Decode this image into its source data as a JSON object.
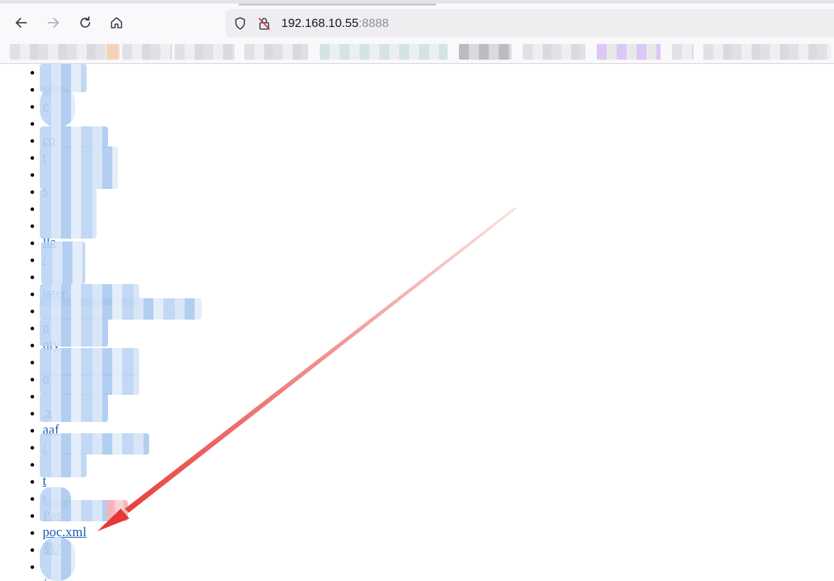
{
  "browser": {
    "url_host": "192.168.10.55",
    "url_port": ":8888",
    "back_icon": "back-arrow-icon",
    "forward_icon": "forward-arrow-icon",
    "reload_icon": "reload-icon",
    "home_icon": "home-icon"
  },
  "listing": {
    "entries": [
      {
        "label": "",
        "blurred": true
      },
      {
        "label": "s/",
        "blurred": true
      },
      {
        "label": "e",
        "blurred": true
      },
      {
        "label": "",
        "blurred": true
      },
      {
        "label": "co",
        "blurred": true
      },
      {
        "label": "t",
        "blurred": true
      },
      {
        "label": "",
        "blurred": true
      },
      {
        "label": "s",
        "blurred": true
      },
      {
        "label": "",
        "blurred": true
      },
      {
        "label": "",
        "blurred": true
      },
      {
        "label": "lla",
        "blurred": true
      },
      {
        "label": "/",
        "blurred": true
      },
      {
        "label": "",
        "blurred": true
      },
      {
        "label": "ister",
        "blurred": true
      },
      {
        "label": "",
        "blurred": true
      },
      {
        "label": "n",
        "blurred": true
      },
      {
        "label": "nty",
        "blurred": true
      },
      {
        "label": "",
        "blurred": true
      },
      {
        "label": "d",
        "blurred": true
      },
      {
        "label": "",
        "blurred": true
      },
      {
        "label": ".z",
        "blurred": true
      },
      {
        "label": "aaf",
        "blurred": true
      },
      {
        "label": "/",
        "blurred": true
      },
      {
        "label": "",
        "blurred": true
      },
      {
        "label": "t",
        "blurred": true
      },
      {
        "label": "t",
        "blurred": true
      },
      {
        "label": "Pas",
        "blurred": true
      },
      {
        "label": "poc.xml",
        "blurred": false
      },
      {
        "label": "载/",
        "blurred": true
      },
      {
        "label": "",
        "blurred": true
      },
      {
        "label": "/",
        "blurred": true
      }
    ]
  },
  "annotation": {
    "arrow_color": "#e53935"
  }
}
